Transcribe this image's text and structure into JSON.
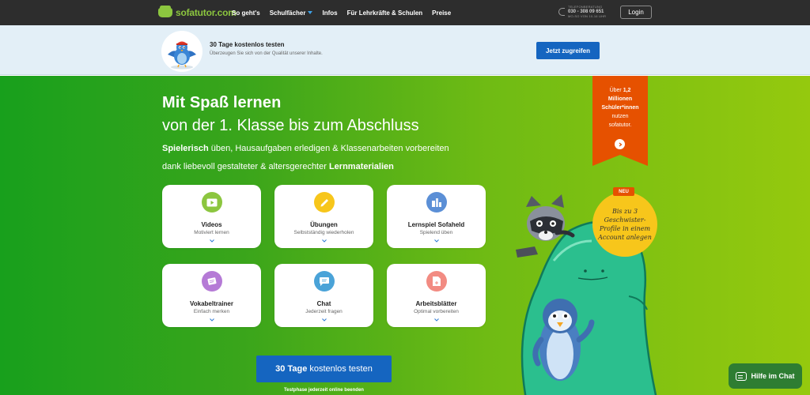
{
  "nav": {
    "logo": "sofatutor.com",
    "links": [
      {
        "label": "So geht's"
      },
      {
        "label": "Schulfächer",
        "dropdown": true
      },
      {
        "label": "Infos"
      },
      {
        "label": "Für Lehrkräfte & Schulen"
      },
      {
        "label": "Preise"
      }
    ],
    "phone": {
      "label": "TELEFONBERATUNG",
      "number": "030 - 308 09 651",
      "hours": "MO-SO VON 10-16 UHR"
    },
    "login": "Login"
  },
  "trial_banner": {
    "title": "30 Tage kostenlos testen",
    "subtitle": "Überzeugen Sie sich von der Qualität unserer Inhalte.",
    "button": "Jetzt zugreifen"
  },
  "hero": {
    "title": "Mit Spaß lernen",
    "subtitle": "von der 1. Klasse bis zum Abschluss",
    "lead1_bold": "Spielerisch",
    "lead1_rest": " üben, Hausaufgaben erledigen & Klassenarbeiten vorbereiten",
    "lead2_rest": "dank liebevoll gestalteter & altersgerechter ",
    "lead2_bold": "Lernmaterialien"
  },
  "cards": [
    {
      "title": "Videos",
      "sub": "Motiviert lernen",
      "color": "#8cc63f",
      "icon": "video-icon"
    },
    {
      "title": "Übungen",
      "sub": "Selbstständig wiederholen",
      "color": "#f7c61b",
      "icon": "exercise-icon"
    },
    {
      "title": "Lernspiel Sofaheld",
      "sub": "Spielend üben",
      "color": "#5b8fd6",
      "icon": "game-icon"
    },
    {
      "title": "Vokabeltrainer",
      "sub": "Einfach merken",
      "color": "#b57ad6",
      "icon": "vocab-icon"
    },
    {
      "title": "Chat",
      "sub": "Jederzeit fragen",
      "color": "#4aa3d8",
      "icon": "chat-icon"
    },
    {
      "title": "Arbeitsblätter",
      "sub": "Optimal vorbereiten",
      "color": "#f28b82",
      "icon": "worksheet-icon"
    }
  ],
  "cta": {
    "bold": "30 Tage",
    "rest": "kostenlos testen",
    "note": "Testphase jederzeit online beenden"
  },
  "ribbon": {
    "l1": "Über ",
    "l1b": "1,2",
    "l2": "Millionen",
    "l3": "Schüler*innen",
    "l4": "nutzen",
    "l5": "sofatutor."
  },
  "badge": "NEU",
  "bubble": "Bis zu 3 Geschwister-Profile in einem Account anlegen",
  "chat": "Hilfe im Chat",
  "colors": {
    "primary_blue": "#1565c0",
    "ribbon_orange": "#e65100",
    "bubble_yellow": "#f7c61b",
    "nav_bg": "#2d2d2d"
  }
}
